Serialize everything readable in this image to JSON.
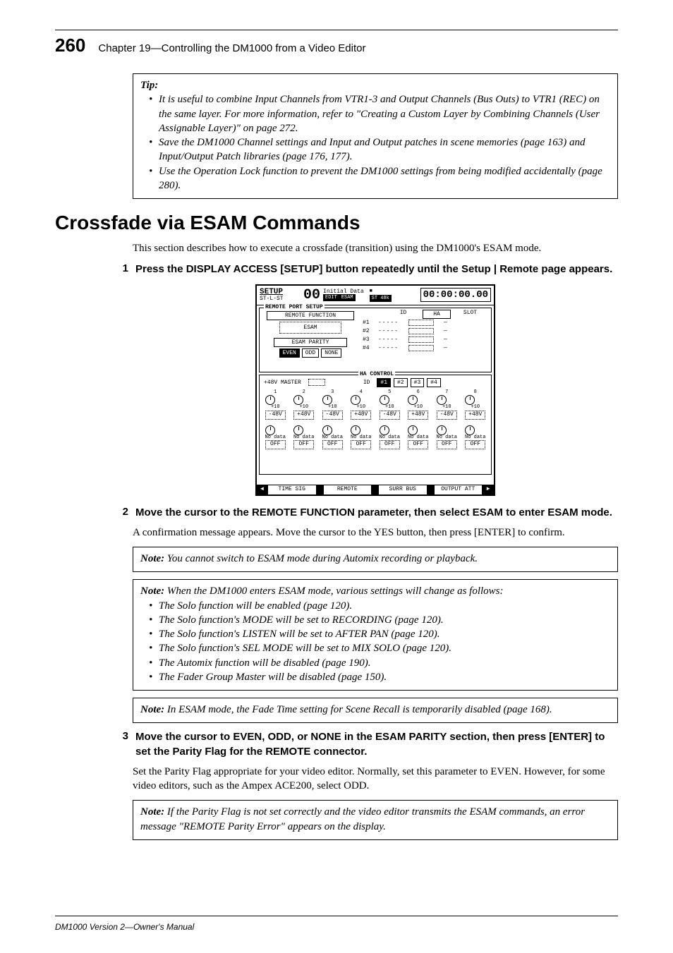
{
  "page_number": "260",
  "chapter_title": "Chapter 19—Controlling the DM1000 from a Video Editor",
  "tip_box": {
    "label": "Tip:",
    "items": [
      "It is useful to combine Input Channels from VTR1-3 and Output Channels (Bus Outs) to VTR1 (REC) on the same layer. For more information, refer to \"Creating a Custom Layer by Combining Channels (User Assignable Layer)\" on page 272.",
      "Save the DM1000 Channel settings and Input and Output patches in scene memories (page 163) and Input/Output Patch libraries (page 176, 177).",
      "Use the Operation Lock function to prevent the DM1000 settings from being modified accidentally (page 280)."
    ]
  },
  "heading": "Crossfade via ESAM Commands",
  "intro": "This section describes how to execute a crossfade (transition) using the DM1000's ESAM mode.",
  "step1": {
    "num": "1",
    "text": "Press the DISPLAY ACCESS [SETUP] button repeatedly until the Setup | Remote page appears."
  },
  "lcd": {
    "title": "SETUP",
    "subtitle": "ST-L-ST",
    "zeros": "00",
    "mid1": "Initial Data",
    "mid2_a": "EDIT",
    "mid2_b": "ESAM",
    "mid3": "ST 48k",
    "timecode": "00:00:00.00",
    "section1_label": "REMOTE PORT SETUP",
    "remote_function": "REMOTE FUNCTION",
    "esam": "ESAM",
    "esam_parity": "ESAM PARITY",
    "parity_even": "EVEN",
    "parity_odd": "ODD",
    "parity_none": "NONE",
    "ha_hdr": "HA",
    "id_hdr": "ID",
    "slot_hdr": "SLOT",
    "ha_rows": [
      "#1",
      "#2",
      "#3",
      "#4"
    ],
    "dash": "-----",
    "em": "—",
    "section2_label": "HA CONTROL",
    "master_label": "+48V MASTER",
    "id2": "ID",
    "id_tabs": [
      "#1",
      "#2",
      "#3",
      "#4"
    ],
    "knob_nums": [
      "1",
      "2",
      "3",
      "4",
      "5",
      "6",
      "7",
      "8"
    ],
    "knob_v1": "+10",
    "knob_v2": "+10",
    "knob_box_a": "-48V",
    "knob_box_b": "+48V",
    "bot_label_a": "No data",
    "bot_label_b": "No data",
    "bot_btn_a": "OFF",
    "bot_btn_b": "OFF",
    "tabs": [
      "TIME SIG",
      "REMOTE",
      "SURR BUS",
      "OUTPUT ATT"
    ],
    "arrow_l": "◄",
    "arrow_r": "►"
  },
  "step2": {
    "num": "2",
    "text": "Move the cursor to the REMOTE FUNCTION parameter, then select ESAM to enter ESAM mode.",
    "body": "A confirmation message appears. Move the cursor to the YES button, then press [ENTER] to confirm."
  },
  "note1": {
    "label": "Note:",
    "text": "You cannot switch to ESAM mode during Automix recording or playback."
  },
  "note2": {
    "label": "Note:",
    "lead": "When the DM1000 enters ESAM mode, various settings will change as follows:",
    "items": [
      "The Solo function will be enabled (page 120).",
      "The Solo function's MODE will be set to RECORDING (page 120).",
      "The Solo function's LISTEN will be set to AFTER PAN (page 120).",
      "The Solo function's SEL MODE will be set to MIX SOLO (page 120).",
      "The Automix function will be disabled (page 190).",
      "The Fader Group Master will be disabled (page 150)."
    ]
  },
  "note3": {
    "label": "Note:",
    "text": "In ESAM mode, the Fade Time setting for Scene Recall is temporarily disabled (page 168)."
  },
  "step3": {
    "num": "3",
    "text": "Move the cursor to EVEN, ODD, or NONE in the ESAM PARITY section, then press [ENTER] to set the Parity Flag for the REMOTE connector.",
    "body": "Set the Parity Flag appropriate for your video editor. Normally, set this parameter to EVEN. However, for some video editors, such as the Ampex ACE200, select ODD."
  },
  "note4": {
    "label": "Note:",
    "text": "If the Parity Flag is not set correctly and the video editor transmits the ESAM commands, an error message \"REMOTE Parity Error\" appears on the display."
  },
  "footer": "DM1000 Version 2—Owner's Manual"
}
